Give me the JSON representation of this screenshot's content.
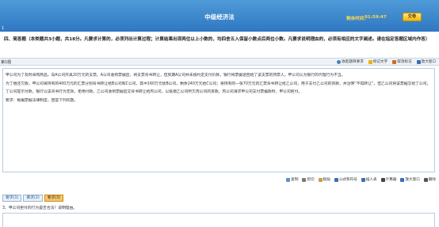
{
  "header": {
    "title": "中级经济法",
    "timer_label": "剩余时间：",
    "timer_value": "01:59:47",
    "submit_label": "交卷",
    "question_number": "1"
  },
  "instruction": "四、简答题（本类题共3小题，共18分。凡要求计算的，必须列出计算过程；计算结果出现两位以上小数的，均四舍五入保留小数点后两位小数。凡要求说明理由的，必须有相应的文字阐述。请在指定答题区域内作答）",
  "question_bar": {
    "question_label": "第1题",
    "tools": [
      {
        "label": "收起题目要求",
        "icon": "collapse-icon",
        "color": "#4c7fbf"
      },
      {
        "label": "标记文字",
        "icon": "highlight-pen-icon",
        "color": "#e8b400"
      },
      {
        "label": "取消标记",
        "icon": "eraser-icon",
        "color": "#d06a2a"
      },
      {
        "label": "放大窗口",
        "icon": "enlarge-icon",
        "color": "#3b6fb4"
      }
    ]
  },
  "passage": [
    "甲公司为了及时采购商品，向A公司开具20万元的支票。A公司收到票据后，将支票背书转让，但到期A公司并未按约定支付价款，银行将票据退回给了该支票的持票人。甲公司认为银行的代理行为不当。",
    "为了偿还欠款，甲公司将持有的400万元的汇票分别背书转让给B公司和C公司，其中160万元给B公司，剩余240万元给C公司；将持有的一张70万元的汇票背书转让给乙公司，用于支付乙公司的货款，并注明“不得转让”。但乙公司将该票据交给丁公司，丁公司提示付款，银行以该背书行为无效，拒绝付款。乙公司收到票据后又背书转让给丙公司，以抵偿乙公司所欠丙公司的货款。丙公司请求甲公司支付票据款时，甲公司拒付。",
    "要求：根据票据法律制度，回答下列问题。"
  ],
  "toolbar": [
    {
      "label": "复制",
      "icon": "copy-icon",
      "color": "#5b8fd6"
    },
    {
      "label": "剪切",
      "icon": "cut-icon",
      "color": "#7a7a7a"
    },
    {
      "label": "粘贴",
      "icon": "paste-icon",
      "color": "#c9a040"
    },
    {
      "label": "公式和符号",
      "icon": "formula-icon",
      "color": "#3b6fb4"
    },
    {
      "label": "插入表",
      "icon": "table-icon",
      "color": "#3b6fb4"
    },
    {
      "label": "计算器",
      "icon": "calculator-icon",
      "color": "#444444"
    },
    {
      "label": "放大窗口",
      "icon": "enlarge-icon",
      "color": "#3b6fb4"
    },
    {
      "label": "删除",
      "icon": "delete-icon",
      "color": "#555555"
    }
  ],
  "subtabs": [
    {
      "label": "要求(1)",
      "active": false
    },
    {
      "label": "要求(2)",
      "active": false
    },
    {
      "label": "要求(3)",
      "active": true
    }
  ],
  "sub_question": "3、甲公司拒付的行为是否合法？说明理由。",
  "answer_value": ""
}
